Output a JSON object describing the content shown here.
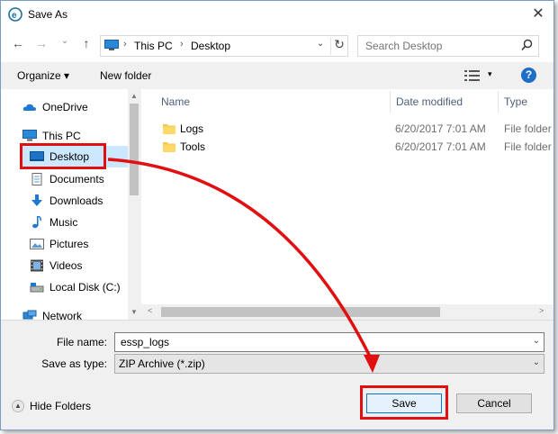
{
  "window": {
    "title": "Save As",
    "close_glyph": "✕"
  },
  "nav": {
    "back_glyph": "←",
    "forward_glyph": "→",
    "recent_glyph": "⌄",
    "up_glyph": "↑",
    "breadcrumb": [
      "This PC",
      "Desktop"
    ],
    "breadcrumb_sep": "›",
    "address_dropdown_glyph": "⌄",
    "refresh_glyph": "↻",
    "search_placeholder": "Search Desktop"
  },
  "toolbar": {
    "organize_label": "Organize ▾",
    "new_folder_label": "New folder",
    "view_dropdown_glyph": "▾",
    "help_label": "?"
  },
  "sidebar": {
    "items": [
      {
        "label": "OneDrive",
        "icon": "cloud-icon"
      },
      {
        "label": "This PC",
        "icon": "computer-icon"
      },
      {
        "label": "Desktop",
        "icon": "desktop-icon"
      },
      {
        "label": "Documents",
        "icon": "document-icon"
      },
      {
        "label": "Downloads",
        "icon": "download-icon"
      },
      {
        "label": "Music",
        "icon": "music-icon"
      },
      {
        "label": "Pictures",
        "icon": "picture-icon"
      },
      {
        "label": "Videos",
        "icon": "video-icon"
      },
      {
        "label": "Local Disk (C:)",
        "icon": "disk-icon"
      },
      {
        "label": "Network",
        "icon": "network-icon"
      }
    ],
    "selected": "Desktop"
  },
  "file_list": {
    "columns": [
      "Name",
      "Date modified",
      "Type"
    ],
    "sort_glyph": "^",
    "rows": [
      {
        "name": "Logs",
        "date": "6/20/2017 7:01 AM",
        "type": "File folder"
      },
      {
        "name": "Tools",
        "date": "6/20/2017 7:01 AM",
        "type": "File folder"
      }
    ]
  },
  "scroll": {
    "up_glyph": "▲",
    "down_glyph": "▼",
    "left_glyph": "<",
    "right_glyph": ">"
  },
  "form": {
    "filename_label": "File name:",
    "filename_value": "essp_logs",
    "filename_dropdown_glyph": "⌄",
    "type_label": "Save as type:",
    "type_value": "ZIP Archive (*.zip)",
    "type_dropdown_glyph": "⌄"
  },
  "footer": {
    "hide_folders_glyph": "▲",
    "hide_folders_label": "Hide Folders",
    "save_label": "Save",
    "cancel_label": "Cancel"
  },
  "colors": {
    "highlight": "#e01010",
    "selected_bg": "#cce8ff",
    "accent": "#1e6ec8"
  }
}
